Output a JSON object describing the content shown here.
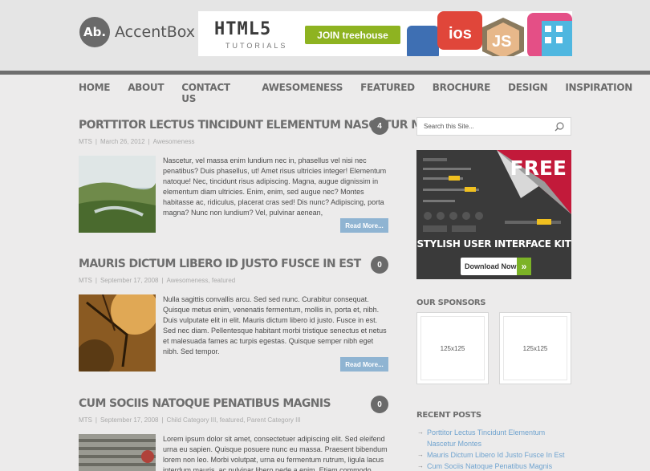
{
  "header": {
    "logo_mark": "Ab.",
    "logo_name": "AccentBox",
    "banner": {
      "title": "HTML5",
      "subtitle": "TUTORIALS",
      "button": "JOIN treehouse",
      "tags": [
        "ios",
        "JS"
      ]
    }
  },
  "nav": {
    "items": [
      "HOME",
      "ABOUT",
      "CONTACT US",
      "AWESOMENESS",
      "FEATURED",
      "BROCHURE",
      "DESIGN",
      "INSPIRATION"
    ]
  },
  "posts": [
    {
      "title": "PORTTITOR LECTUS TINCIDUNT ELEMENTUM NASCETUR MONTES",
      "comments": "4",
      "author": "MTS",
      "date": "March 26, 2012",
      "categories": "Awesomeness",
      "excerpt": "Nascetur, vel massa enim lundium nec in, phasellus vel nisi nec penatibus? Duis phasellus, ut! Amet risus ultricies integer! Elementum natoque! Nec, tincidunt risus adipiscing. Magna, augue dignissim in elementum diam ultricies. Enim, enim, sed augue nec? Montes habitasse ac, ridiculus, placerat cras sed! Dis nunc? Adipiscing, porta magna? Nunc non lundium? Vel, pulvinar aenean,",
      "read_more": "Read More..."
    },
    {
      "title": "MAURIS DICTUM LIBERO ID JUSTO FUSCE IN EST",
      "comments": "0",
      "author": "MTS",
      "date": "September 17, 2008",
      "categories": "Awesomeness, featured",
      "excerpt": "Nulla sagittis convallis arcu. Sed sed nunc. Curabitur consequat. Quisque metus enim, venenatis fermentum, mollis in, porta et, nibh. Duis vulputate elit in elit. Mauris dictum libero id justo. Fusce in est. Sed nec diam. Pellentesque habitant morbi tristique senectus et netus et malesuada fames ac turpis egestas. Quisque semper nibh eget nibh. Sed tempor.",
      "read_more": "Read More..."
    },
    {
      "title": "CUM SOCIIS NATOQUE PENATIBUS MAGNIS",
      "comments": "0",
      "author": "MTS",
      "date": "September 17, 2008",
      "categories": "Child Category III, featured, Parent Category III",
      "excerpt": "Lorem ipsum dolor sit amet, consectetuer adipiscing elit. Sed eleifend urna eu sapien. Quisque posuere nunc eu massa. Praesent bibendum lorem non leo. Morbi volutpat, urna eu fermentum rutrum, ligula lacus interdum mauris, ac pulvinar libero pede a enim. Etiam commodo",
      "read_more": ""
    }
  ],
  "sidebar": {
    "search_placeholder": "Search this Site...",
    "ad": {
      "free": "FREE",
      "headline": "STYLISH USER INTERFACE KIT",
      "download": "Download Now"
    },
    "sponsors_heading": "OUR SPONSORS",
    "sponsors": [
      "125x125",
      "125x125"
    ],
    "recent_heading": "RECENT POSTS",
    "recent_posts": [
      "Porttitor Lectus Tincidunt Elementum Nascetur Montes",
      "Mauris Dictum Libero Id Justo Fusce In Est",
      "Cum Sociis Natoque Penatibus Magnis"
    ]
  },
  "colors": {
    "accent_link": "#6fa3cf",
    "read_more_bg": "#8fb4d2",
    "badge_bg": "#6a6a6a"
  }
}
